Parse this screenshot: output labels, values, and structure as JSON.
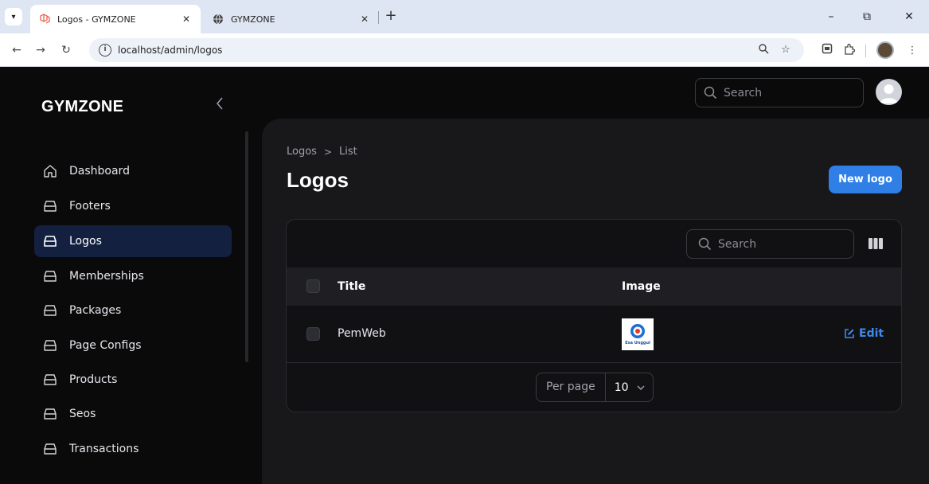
{
  "browser": {
    "tabs": [
      {
        "title": "Logos - GYMZONE",
        "active": true
      },
      {
        "title": "GYMZONE",
        "active": false
      }
    ],
    "url": "localhost/admin/logos",
    "window_controls": {
      "minimize": "–",
      "restore": "⧉",
      "close": "✕"
    }
  },
  "app": {
    "brand": "GYMZONE",
    "top_search": {
      "placeholder": "Search"
    },
    "sidebar": {
      "items": [
        {
          "label": "Dashboard",
          "icon": "home-icon",
          "active": false
        },
        {
          "label": "Footers",
          "icon": "tray-icon",
          "active": false
        },
        {
          "label": "Logos",
          "icon": "tray-icon",
          "active": true
        },
        {
          "label": "Memberships",
          "icon": "tray-icon",
          "active": false
        },
        {
          "label": "Packages",
          "icon": "tray-icon",
          "active": false
        },
        {
          "label": "Page Configs",
          "icon": "tray-icon",
          "active": false
        },
        {
          "label": "Products",
          "icon": "tray-icon",
          "active": false
        },
        {
          "label": "Seos",
          "icon": "tray-icon",
          "active": false
        },
        {
          "label": "Transactions",
          "icon": "tray-icon",
          "active": false
        }
      ]
    },
    "breadcrumb": {
      "parent": "Logos",
      "separator": ">",
      "current": "List"
    },
    "page_title": "Logos",
    "new_button": "New logo",
    "table": {
      "search_placeholder": "Search",
      "columns": [
        "Title",
        "Image"
      ],
      "rows": [
        {
          "title": "PemWeb",
          "image_logo_text": "Esa Unggul",
          "action": "Edit"
        }
      ],
      "pagination": {
        "label": "Per page",
        "value": "10"
      }
    },
    "colors": {
      "accent": "#2f7fe6",
      "link": "#3b8af0",
      "active_nav": "#132040",
      "panel": "#18181b",
      "background": "#0a0a0b"
    }
  }
}
